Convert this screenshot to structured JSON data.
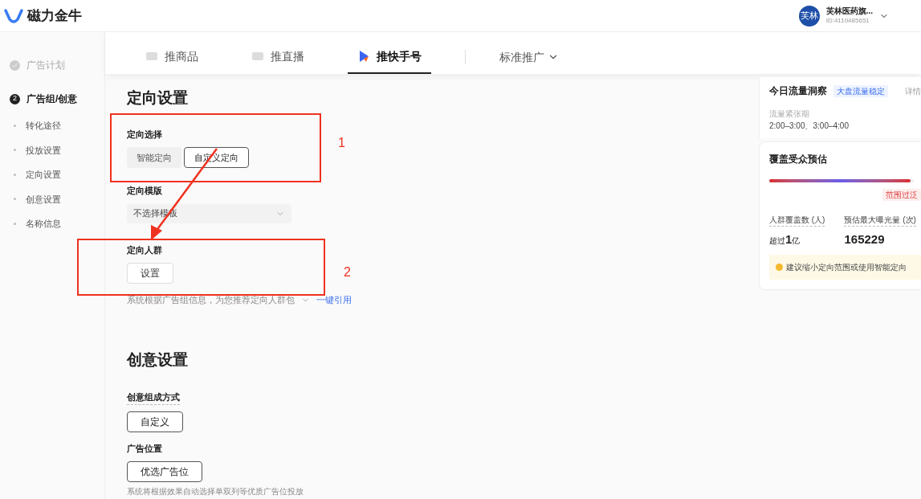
{
  "header": {
    "logo_text": "磁力金牛",
    "account": {
      "avatar_text": "芙林",
      "name": "芙林医药旗...",
      "id": "ID:4110485651"
    }
  },
  "sidebar": {
    "steps": [
      {
        "label": "广告计划",
        "current": false
      },
      {
        "number": "2",
        "label": "广告组/创意",
        "current": true
      }
    ],
    "items": [
      "转化途径",
      "投放设置",
      "定向设置",
      "创意设置",
      "名称信息"
    ]
  },
  "tabs": [
    {
      "label": "推商品",
      "selected": false
    },
    {
      "label": "推直播",
      "selected": false
    },
    {
      "label": "推快手号",
      "selected": true
    }
  ],
  "mode_dropdown": "标准推广",
  "targeting": {
    "title": "定向设置",
    "choice_label": "定向选择",
    "options": [
      {
        "label": "智能定向",
        "selected": false
      },
      {
        "label": "自定义定向",
        "selected": true
      }
    ],
    "template_label": "定向模版",
    "template_value": "不选择模板",
    "audience_label": "定向人群",
    "audience_button": "设置",
    "recommend_text": "系统根据广告组信息，为您推荐定向人群包",
    "recommend_link": "一键引用"
  },
  "creative": {
    "title": "创意设置",
    "compose_label": "创意组成方式",
    "compose_button": "自定义",
    "placement_label": "广告位置",
    "placement_button": "优选广告位",
    "placement_hint": "系统将根据效果自动选择单双列等优质广告位投放"
  },
  "traffic_card": {
    "title": "今日流量洞察",
    "badge": "大盘流量稳定",
    "detail_link": "详情",
    "period_label": "流量紧张期",
    "period_value": "2:00–3:00、3:00–4:00"
  },
  "audience_card": {
    "title": "覆盖受众预估",
    "level": 0.98,
    "range_badge": "范围过泛",
    "metrics": [
      {
        "label": "人群覆盖数 (人)",
        "prefix": "超过",
        "value": "1",
        "suffix": "亿"
      },
      {
        "label": "预估最大曝光量 (次)",
        "value": "165229"
      }
    ],
    "tip": "建议缩小定向范围或使用智能定向"
  },
  "annotations": [
    "1",
    "2"
  ]
}
